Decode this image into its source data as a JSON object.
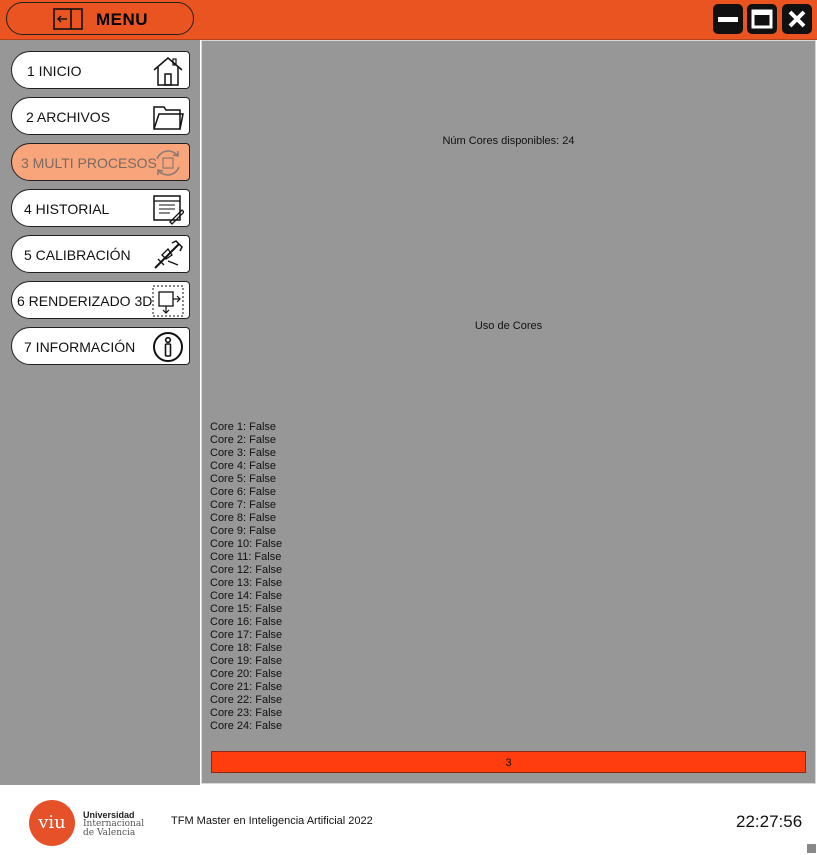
{
  "header": {
    "menu_label": "MENU",
    "menu_icon": "exit-icon",
    "controls": [
      "minimize-icon",
      "maximize-icon",
      "close-icon"
    ]
  },
  "sidebar": {
    "items": [
      {
        "label": "1 INICIO",
        "icon": "home-icon",
        "active": false
      },
      {
        "label": "2 ARCHIVOS",
        "icon": "folder-icon",
        "active": false
      },
      {
        "label": "3 MULTI PROCESOS",
        "icon": "refresh-icon",
        "active": true
      },
      {
        "label": "4 HISTORIAL",
        "icon": "history-list-icon",
        "active": false
      },
      {
        "label": "5 CALIBRACIÓN",
        "icon": "caliper-icon",
        "active": false
      },
      {
        "label": "6 RENDERIZADO 3D",
        "icon": "cube-render-icon",
        "active": false
      },
      {
        "label": "7 INFORMACIÓN",
        "icon": "info-icon",
        "active": false
      }
    ]
  },
  "main": {
    "cores_available": "Núm Cores disponibles: 24",
    "cores_usage_title": "Uso de Cores",
    "cores": [
      "Core 1: False",
      "Core 2: False",
      "Core 3: False",
      "Core 4: False",
      "Core 5: False",
      "Core 6: False",
      "Core 7: False",
      "Core 8: False",
      "Core 9: False",
      "Core 10: False",
      "Core 11: False",
      "Core 12: False",
      "Core 13: False",
      "Core 14: False",
      "Core 15: False",
      "Core 16: False",
      "Core 17: False",
      "Core 18: False",
      "Core 19: False",
      "Core 20: False",
      "Core 21: False",
      "Core 22: False",
      "Core 23: False",
      "Core 24: False"
    ],
    "progress": {
      "label": "3",
      "fraction": 1.0
    }
  },
  "footer": {
    "logo_mark": "viu",
    "logo_line1": "Universidad",
    "logo_line2": "Internacional",
    "logo_line3": "de Valencia",
    "title": "TFM Master en Inteligencia Artificial 2022",
    "time": "22:27:56"
  },
  "colors": {
    "accent": "#e95420",
    "active_item": "#f8a57c",
    "panel_bg": "#979797",
    "progress_fill": "#ff3d0f"
  }
}
